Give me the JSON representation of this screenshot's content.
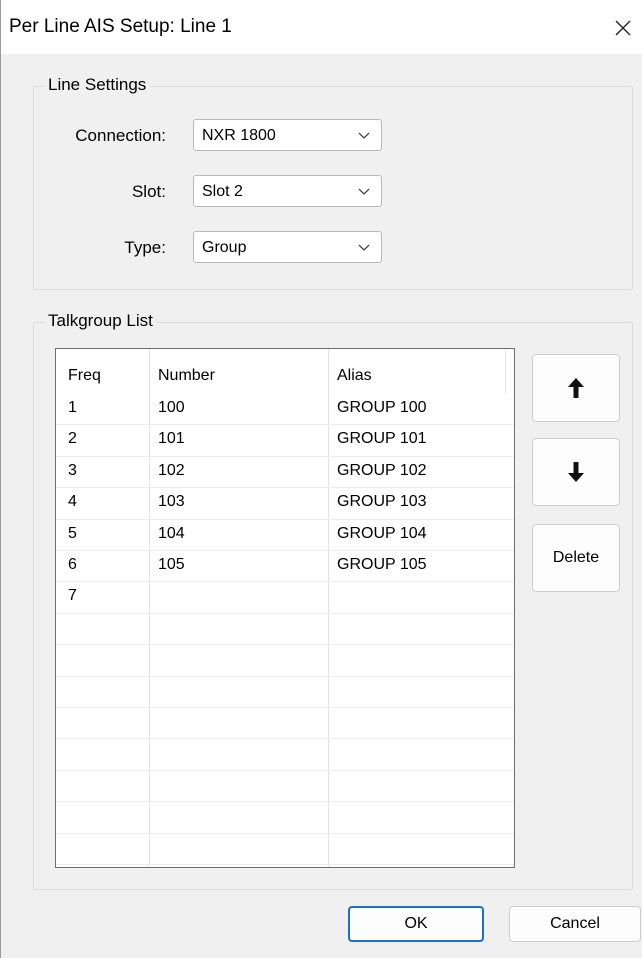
{
  "window": {
    "title": "Per Line AIS Setup: Line 1"
  },
  "line_settings": {
    "legend": "Line Settings",
    "connection": {
      "label": "Connection:",
      "value": "NXR 1800"
    },
    "slot": {
      "label": "Slot:",
      "value": "Slot 2"
    },
    "type": {
      "label": "Type:",
      "value": "Group"
    }
  },
  "talkgroup": {
    "legend": "Talkgroup List",
    "columns": [
      "Freq",
      "Number",
      "Alias"
    ],
    "rows": [
      [
        "1",
        "100",
        "GROUP 100"
      ],
      [
        "2",
        "101",
        "GROUP 101"
      ],
      [
        "3",
        "102",
        "GROUP 102"
      ],
      [
        "4",
        "103",
        "GROUP 103"
      ],
      [
        "5",
        "104",
        "GROUP 104"
      ],
      [
        "6",
        "105",
        "GROUP 105"
      ],
      [
        "7",
        "",
        ""
      ]
    ]
  },
  "side_buttons": {
    "delete_label": "Delete"
  },
  "footer": {
    "ok_label": "OK",
    "cancel_label": "Cancel"
  },
  "colors": {
    "default_button_border": "#1a6fd1"
  }
}
